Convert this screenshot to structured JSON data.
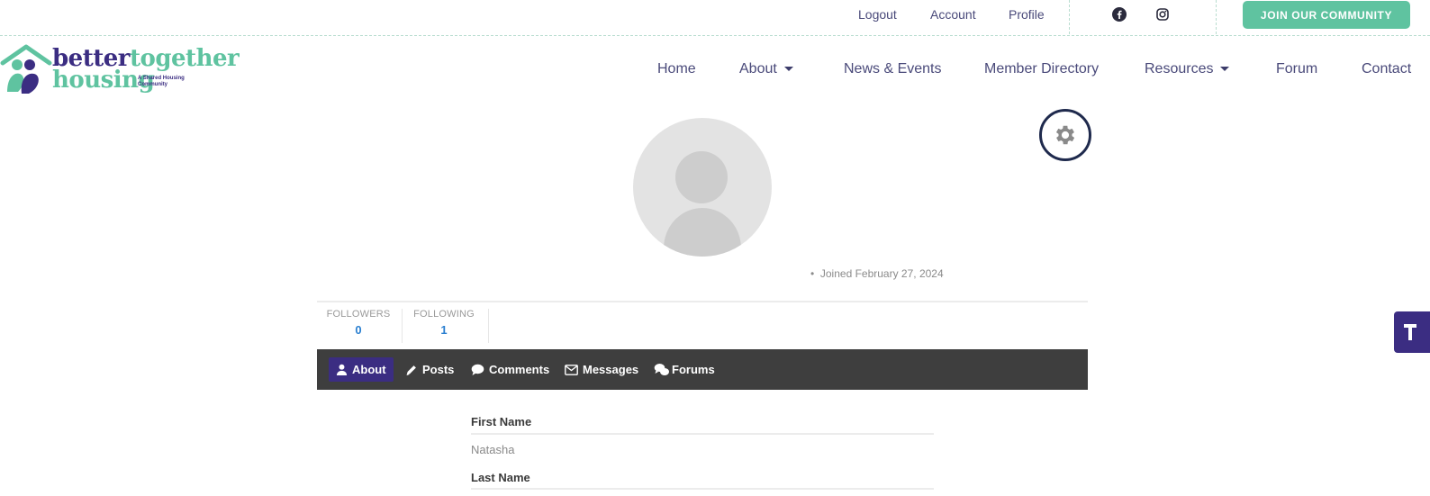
{
  "topbar": {
    "links": [
      "Logout",
      "Account",
      "Profile"
    ],
    "social_icons": [
      "facebook-icon",
      "instagram-icon"
    ],
    "join_label": "JOIN OUR COMMUNITY"
  },
  "logo": {
    "word1": "better",
    "word2": "together",
    "word3": "housing",
    "tagline_line1": "A Shared Housing",
    "tagline_line2": "Community"
  },
  "nav": {
    "items": [
      {
        "label": "Home",
        "has_dropdown": false
      },
      {
        "label": "About",
        "has_dropdown": true
      },
      {
        "label": "News & Events",
        "has_dropdown": false
      },
      {
        "label": "Member Directory",
        "has_dropdown": false
      },
      {
        "label": "Resources",
        "has_dropdown": true
      },
      {
        "label": "Forum",
        "has_dropdown": false
      },
      {
        "label": "Contact",
        "has_dropdown": false
      }
    ]
  },
  "profile": {
    "joined": "Joined February 27, 2024",
    "stats": [
      {
        "label": "FOLLOWERS",
        "value": "0"
      },
      {
        "label": "FOLLOWING",
        "value": "1"
      }
    ],
    "tabs": [
      {
        "label": "About",
        "icon": "user-icon",
        "active": true
      },
      {
        "label": "Posts",
        "icon": "pencil-icon",
        "active": false
      },
      {
        "label": "Comments",
        "icon": "comment-icon",
        "active": false
      },
      {
        "label": "Messages",
        "icon": "envelope-icon",
        "active": false
      },
      {
        "label": "Forums",
        "icon": "forums-icon",
        "active": false
      }
    ],
    "fields": [
      {
        "label": "First Name",
        "value": "Natasha"
      },
      {
        "label": "Last Name",
        "value": ""
      }
    ]
  },
  "colors": {
    "accent_green": "#5fc3a0",
    "brand_purple": "#3b2d82",
    "tab_bar": "#3e3e3e",
    "stat_blue": "#2a7fd0"
  }
}
